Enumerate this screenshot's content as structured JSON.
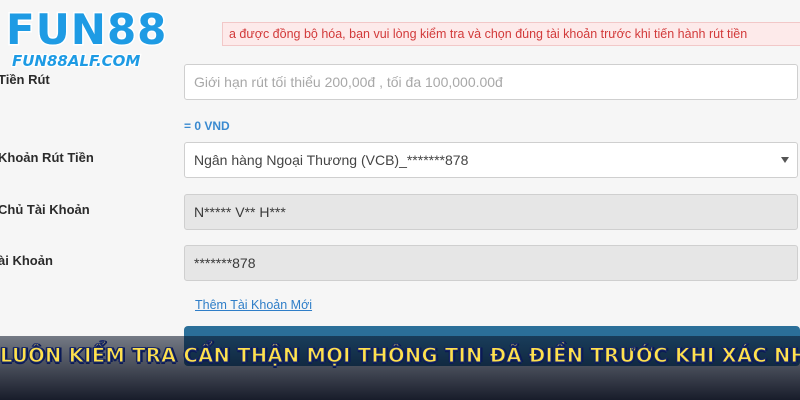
{
  "brand": {
    "logo_text": "FUN88",
    "logo_subtext": "FUN88ALF.COM",
    "logo_color": "#1e9be4"
  },
  "notice": {
    "text": "a được đồng bộ hóa, bạn vui lòng kiểm tra và chọn đúng tài khoản trước khi tiến hành rút tiền"
  },
  "form": {
    "amount": {
      "label": "Tiền Rút",
      "placeholder": "Giới hạn rút tối thiểu 200,00đ , tối đa 100,000.00đ",
      "converted": "= 0 VND"
    },
    "bank_account": {
      "label": "Khoản Rút Tiền",
      "selected": "Ngân hàng Ngoại Thương (VCB)_*******878"
    },
    "account_holder": {
      "label": "Chủ Tài Khoản",
      "value": "N***** V** H***"
    },
    "account_number": {
      "label": "ài Khoản",
      "value": "*******878"
    },
    "add_account_link": "Thêm Tài Khoản Mới"
  },
  "banner": {
    "text": "LUÔN KIỂM TRA CẨN THẬN MỌI THÔNG TIN ĐÃ ĐIỀN TRƯỚC KHI XÁC NHẬN",
    "text_color": "#ffe14d"
  }
}
